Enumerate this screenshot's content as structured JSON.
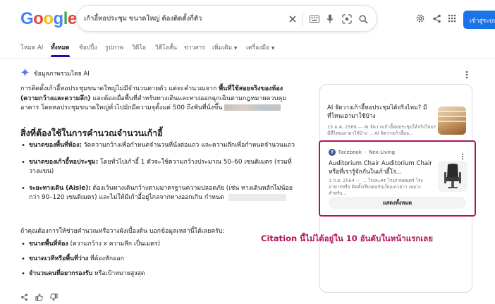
{
  "header": {
    "logo_letters": [
      "G",
      "o",
      "o",
      "g",
      "l",
      "e"
    ],
    "search_value": "เก้าอี้หอประชุม ขนาดใหญ่ ต้องติดตั้งกี่ตัว",
    "signin_label": "เข้าสู่ระบบ"
  },
  "tabs": [
    {
      "label": "โหมด AI"
    },
    {
      "label": "ทั้งหมด"
    },
    {
      "label": "ช้อปปิ้ง"
    },
    {
      "label": "รูปภาพ"
    },
    {
      "label": "วิดีโอ"
    },
    {
      "label": "วิดีโอสั้น"
    },
    {
      "label": "ข่าวสาร"
    },
    {
      "label": "เพิ่มเติม"
    },
    {
      "label": "เครื่องมือ"
    }
  ],
  "ai_overview": {
    "label": "ข้อมูลภาพรวมโดย AI",
    "intro_plain_1": "การติดตั้งเก้าอี้หอประชุมขนาดใหญ่ไม่มีจำนวนตายตัว แต่จะคำนวณจาก ",
    "intro_bold": "พื้นที่ใช้สอยจริงของห้อง (ความกว้างและความลึก)",
    "intro_plain_2": " และต้องเผื่อพื้นที่สำหรับทางเดินและทางออกฉุกเฉินตามกฎหมายควบคุมอาคาร โดยหอประชุมขนาดใหญ่ทั่วไปมักมีความจุตั้งแต่ 500 ถึงพันที่นั่งขึ้น",
    "section_title": "สิ่งที่ต้องใช้ในการคำนวณจำนวนเก้าอี้",
    "factors": [
      {
        "term": "ขนาดของพื้นที่ห้อง:",
        "desc": " วัดความกว้างเพื่อกำหนดจำนวนที่นั่งต่อแถว และความลึกเพื่อกำหนดจำนวนแถว"
      },
      {
        "term": "ขนาดของเก้าอี้หอประชุม:",
        "desc": " โดยทั่วไปเก้าอี้ 1 ตัวจะใช้ความกว้างประมาณ 50–60 เซนติเมตร (รวมที่วางแขน)"
      },
      {
        "term": "ระยะทางเดิน (Aisle):",
        "desc": " ต้องเว้นทางเดินกว้างตามมาตรฐานความปลอดภัย (เช่น ทางเดินหลักไม่น้อยกว่า 90–120 เซนติเมตร) และไม่ให้มีเก้าอี้อยู่ไกลจากทางออกเกิน กำหนด"
      }
    ],
    "intro2": "ถ้าคุณต้องการให้ช่วยคำนวณหรือวางผังเบื้องต้น บอกข้อมูลเหล่านี้ได้เลยครับ:",
    "needs": [
      {
        "term": "ขนาดพื้นที่ห้อง",
        "desc": " (ความกว้าง x ความลึก เป็นเมตร)"
      },
      {
        "term": "ขนาดเวทีหรือพื้นที่ว่าง",
        "desc": " ที่ต้องหักออก"
      },
      {
        "term": "จำนวนคนที่อยากรองรับ",
        "desc": " หรือเป้าหมายสูงสุด"
      }
    ]
  },
  "side_panel": {
    "card1": {
      "title": "AI จัดวางเก้าอี้หอประชุมได้จริงไหม? มีที่ไหนเอามาใช้บ้าง",
      "meta": "15 ม.ค. 2569 — AI จัดวางเก้าอี้หอประชุมได้จริงไหม? มีที่ไหนเอามาใช้บ้าง ... AI จัดวางเก้าอี้หอ..."
    },
    "card2": {
      "source": "Facebook",
      "author": "Nex-Living",
      "title": "Auditorium Chair Auditorium Chair หรือที่เรารู้จักกันในเก้าอี้โร...",
      "meta": "1 ก.ย. 2564 — ... โรงละคร โรงภาพยนตร์ โรงอาหารหรือ ติดตั้งเรียงต่อกันเป็นแถวยาว เหมาะสำหรับ...",
      "showall_label": "แสดงทั้งหมด"
    }
  },
  "annotation": "Citation นี้ไม่ได้อยู่ใน 10 อันดับในหน้าแรกเลย",
  "colors": {
    "accent": "#1a73e8",
    "annotation": "#b2135c",
    "tab_active": "#1a0dab"
  }
}
